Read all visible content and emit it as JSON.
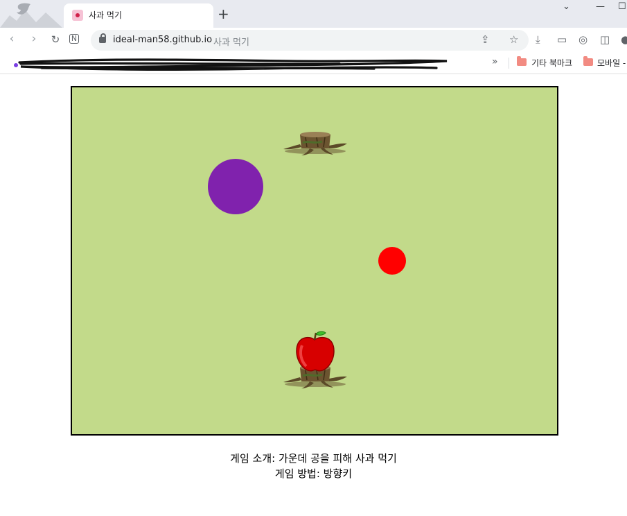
{
  "browser": {
    "tab_title": "사과 먹기",
    "new_tab": "+",
    "url_host": "ideal-man58.github.io",
    "url_page_title": "사과 먹기"
  },
  "bookmarks": {
    "overflow": "»",
    "items": [
      {
        "label": "기타 북마크",
        "icon": "folder-icon"
      },
      {
        "label": "모바일 -",
        "icon": "folder-icon"
      }
    ]
  },
  "game": {
    "background": "#c2da8a",
    "big_ball_color": "#8022ad",
    "small_ball_color": "#ff0000"
  },
  "footer": {
    "intro": "게임 소개: 가운데 공을 피해 사과 먹기",
    "howto": "게임 방법: 방향키"
  }
}
